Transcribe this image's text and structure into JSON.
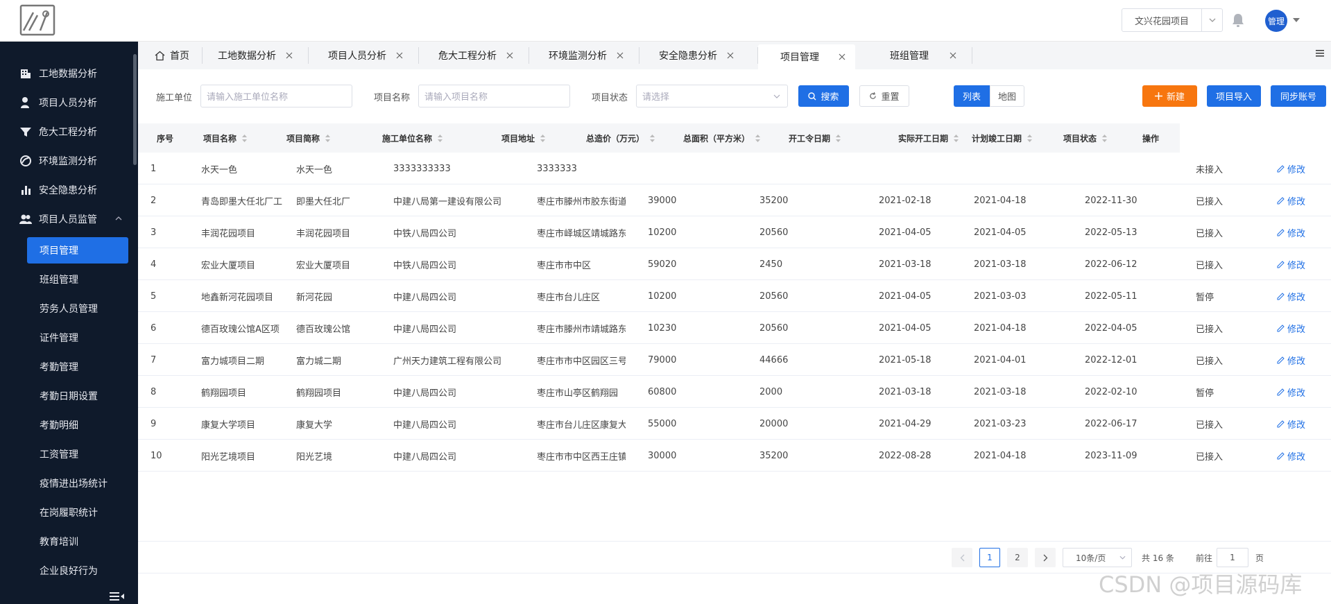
{
  "header": {
    "project_selector": "文兴花园项目",
    "user_avatar": "管理"
  },
  "sidebar": {
    "menu": [
      {
        "label": "工地数据分析",
        "icon": "building-icon"
      },
      {
        "label": "项目人员分析",
        "icon": "person-icon"
      },
      {
        "label": "危大工程分析",
        "icon": "filter-icon"
      },
      {
        "label": "环境监测分析",
        "icon": "leaf-icon"
      },
      {
        "label": "安全隐患分析",
        "icon": "bar-chart-icon"
      },
      {
        "label": "项目人员监管",
        "icon": "users-icon"
      }
    ],
    "submenu": [
      "项目管理",
      "班组管理",
      "劳务人员管理",
      "证件管理",
      "考勤管理",
      "考勤日期设置",
      "考勤明细",
      "工资管理",
      "疫情进出场统计",
      "在岗履职统计",
      "教育培训",
      "企业良好行为"
    ]
  },
  "tabs": [
    "首页",
    "工地数据分析",
    "项目人员分析",
    "危大工程分析",
    "环境监测分析",
    "安全隐患分析",
    "项目管理",
    "班组管理"
  ],
  "filter": {
    "unit_label": "施工单位",
    "unit_placeholder": "请输入施工单位名称",
    "name_label": "项目名称",
    "name_placeholder": "请输入项目名称",
    "status_label": "项目状态",
    "status_placeholder": "请选择",
    "search": "搜索",
    "reset": "重置",
    "view_list": "列表",
    "view_map": "地图",
    "new": "新建",
    "import": "项目导入",
    "sync": "同步账号"
  },
  "table": {
    "columns": [
      "序号",
      "项目名称",
      "项目简称",
      "施工单位名称",
      "项目地址",
      "总造价（万元）",
      "总面积（平方米）",
      "开工令日期",
      "实际开工日期",
      "计划竣工日期",
      "项目状态",
      "操作"
    ],
    "edit_label": "修改",
    "rows": [
      [
        "1",
        "水天一色",
        "水天一色",
        "3333333333",
        "3333333",
        "",
        "",
        "",
        "",
        "",
        "未接入"
      ],
      [
        "2",
        "青岛即墨大任北厂工",
        "即墨大任北厂",
        "中建八局第一建设有限公司",
        "枣庄市滕州市胶东街道",
        "39000",
        "35200",
        "2021-02-18",
        "2021-04-18",
        "2022-11-30",
        "已接入"
      ],
      [
        "3",
        "丰润花园项目",
        "丰润花园项目",
        "中铁八局四公司",
        "枣庄市峄城区靖城路东",
        "10200",
        "20560",
        "2021-04-05",
        "2021-04-05",
        "2022-05-13",
        "已接入"
      ],
      [
        "4",
        "宏业大厦项目",
        "宏业大厦项目",
        "中铁八局四公司",
        "枣庄市市中区",
        "59020",
        "2450",
        "2021-03-18",
        "2021-03-18",
        "2022-06-12",
        "已接入"
      ],
      [
        "5",
        "地鑫新河花园项目",
        "新河花园",
        "中建八局四公司",
        "枣庄市台儿庄区",
        "10200",
        "20560",
        "2021-04-05",
        "2021-03-03",
        "2022-05-11",
        "暂停"
      ],
      [
        "6",
        "德百玫瑰公馆A区项",
        "德百玫瑰公馆",
        "中建八局四公司",
        "枣庄市滕州市靖城路东",
        "10230",
        "20560",
        "2021-04-05",
        "2021-04-18",
        "2022-04-05",
        "已接入"
      ],
      [
        "7",
        "富力城项目二期",
        "富力城二期",
        "广州天力建筑工程有限公司",
        "枣庄市市中区园区三号",
        "79000",
        "44666",
        "2021-05-18",
        "2021-04-01",
        "2022-12-01",
        "已接入"
      ],
      [
        "8",
        "鹤翔园项目",
        "鹤翔园项目",
        "中建八局四公司",
        "枣庄市山亭区鹤翔园",
        "60800",
        "2000",
        "2021-03-18",
        "2021-03-18",
        "2022-02-10",
        "暂停"
      ],
      [
        "9",
        "康复大学项目",
        "康复大学",
        "中建八局四公司",
        "枣庄市台儿庄区康复大",
        "55000",
        "20000",
        "2021-04-29",
        "2021-03-23",
        "2022-06-17",
        "已接入"
      ],
      [
        "10",
        "阳光艺境项目",
        "阳光艺境",
        "中建八局四公司",
        "枣庄市市中区西王庄镇",
        "30000",
        "35200",
        "2022-08-28",
        "2021-04-18",
        "2023-11-09",
        "已接入"
      ]
    ]
  },
  "pagination": {
    "pages": [
      "1",
      "2"
    ],
    "page_size": "10条/页",
    "total": "共 16 条",
    "goto_label": "前往",
    "goto_value": "1",
    "page_unit": "页"
  },
  "watermark": "CSDN @项目源码库"
}
